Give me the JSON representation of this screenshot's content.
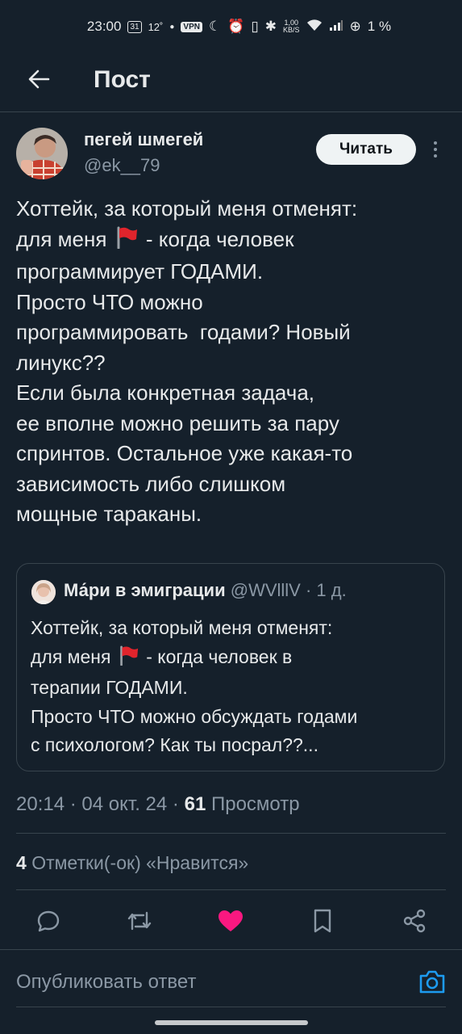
{
  "status_bar": {
    "time": "23:00",
    "calendar_day": "31",
    "temperature": "12˚",
    "vpn": "VPN",
    "net_speed_value": "1,00",
    "net_speed_unit": "KB/S",
    "battery_text": "1 %"
  },
  "header": {
    "title": "Пост"
  },
  "author": {
    "name": "пегей шмегей",
    "handle": "@ek__79",
    "follow_label": "Читать"
  },
  "tweet": {
    "lines": [
      "Хоттейк, за который меня отменят:",
      "для меня",
      "- когда человек",
      "программирует ГОДАМИ.",
      "Просто ЧТО можно",
      "программировать  годами? Новый",
      "линукс??",
      "Если была конкретная задача,",
      "ее вполне можно решить за пару",
      "спринтов. Остальное уже какая-то",
      "зависимость либо слишком",
      "мощные тараканы."
    ]
  },
  "quote": {
    "name": "Ма́ри в эмиграции",
    "handle": "@WVlllV",
    "time": "· 1 д.",
    "lines": [
      "Хоттейк, за который меня отменят:",
      "для меня",
      "- когда человек в",
      "терапии ГОДАМИ.",
      "Просто ЧТО можно обсуждать годами",
      "с психологом? Как ты посрал??..."
    ]
  },
  "meta": {
    "time": "20:14",
    "date": "04 окт. 24",
    "views_count": "61",
    "views_label": "Просмотр"
  },
  "likes": {
    "count": "4",
    "label": "Отметки(-ок) «Нравится»"
  },
  "reply": {
    "placeholder": "Опубликовать ответ"
  },
  "colors": {
    "background": "#15202b",
    "text": "#e7e9ea",
    "secondary": "#8b98a5",
    "divider": "#38444d",
    "like": "#f91880",
    "accent": "#1d9bf0",
    "flag": "#e0242c"
  },
  "icons": [
    "back-arrow-icon",
    "more-vertical-icon",
    "red-flag-emoji",
    "reply-icon",
    "retweet-icon",
    "heart-icon",
    "bookmark-icon",
    "share-icon",
    "camera-icon"
  ]
}
